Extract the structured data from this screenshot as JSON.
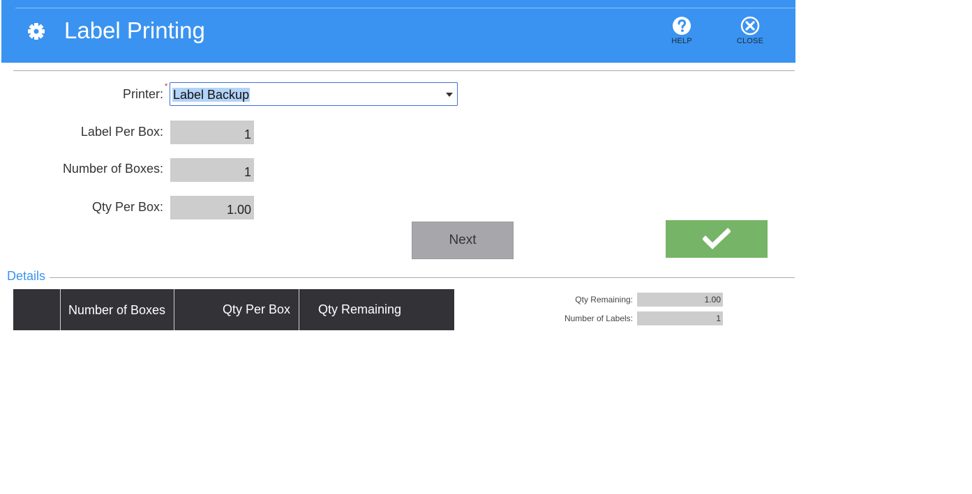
{
  "header": {
    "title": "Label Printing",
    "help_label": "HELP",
    "close_label": "CLOSE"
  },
  "form": {
    "printer_label": "Printer:",
    "printer_value": "Label Backup",
    "label_per_box_label": "Label Per Box:",
    "label_per_box_value": "1",
    "number_of_boxes_label": "Number of Boxes:",
    "number_of_boxes_value": "1",
    "qty_per_box_label": "Qty Per Box:",
    "qty_per_box_value": "1.00"
  },
  "actions": {
    "next_label": "Next",
    "confirm_icon": "checkmark-icon"
  },
  "details": {
    "legend": "Details",
    "columns": [
      "",
      "Number of Boxes",
      "Qty Per Box",
      "Qty Remaining"
    ],
    "rows": [],
    "qty_remaining_label": "Qty Remaining:",
    "qty_remaining_value": "1.00",
    "number_of_labels_label": "Number of Labels:",
    "number_of_labels_value": "1"
  },
  "colors": {
    "header_bg": "#3a93f0",
    "confirm_bg": "#76b467",
    "next_bg": "#a7a7ab",
    "grid_header_bg": "#333237"
  }
}
